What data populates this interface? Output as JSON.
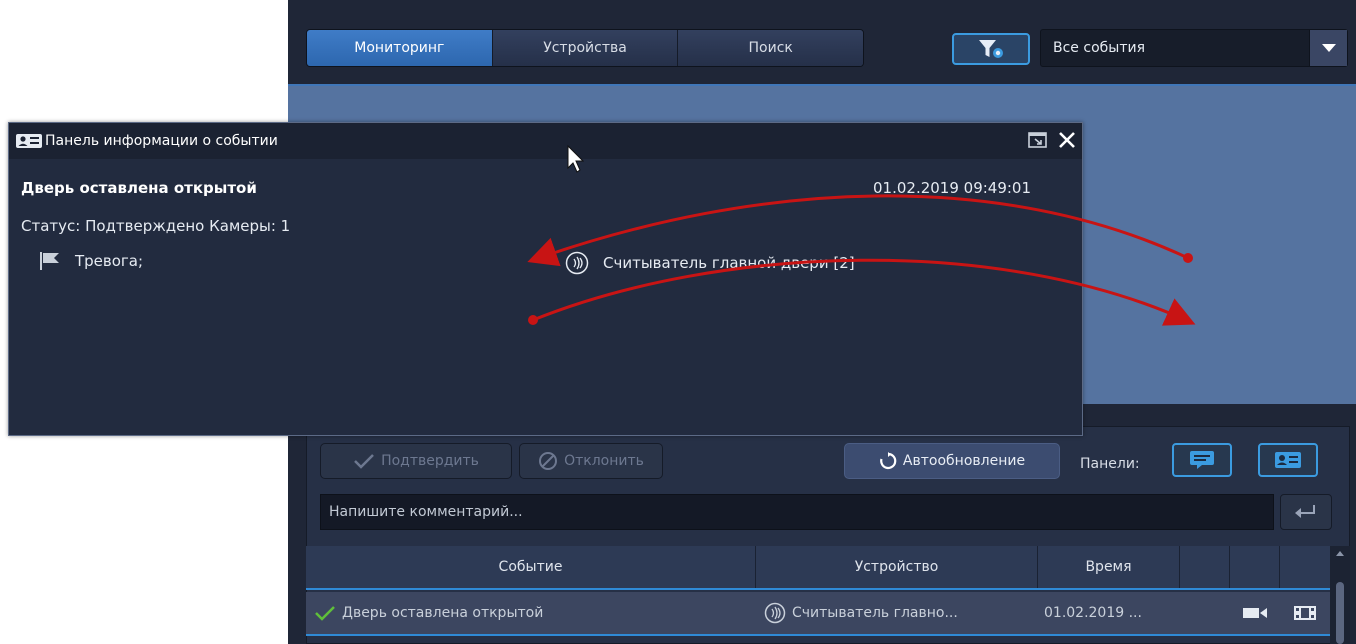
{
  "tabs": [
    {
      "label": "Мониторинг",
      "active": true
    },
    {
      "label": "Устройства",
      "active": false
    },
    {
      "label": "Поиск",
      "active": false
    }
  ],
  "event_filter": {
    "selected": "Все события"
  },
  "info_panel": {
    "title": "Панель информации о событии",
    "event_name": "Дверь оставлена открытой",
    "event_time": "01.02.2019 09:49:01",
    "status_line": "Статус: Подтверждено Камеры: 1",
    "flag_label": "Тревога;",
    "device_label": "Считыватель главной двери [2]"
  },
  "actions": {
    "confirm": "Подтвердить",
    "reject": "Отклонить",
    "autoupdate": "Автообновление",
    "panels_label": "Панели:"
  },
  "comment": {
    "placeholder": "Напишите комментарий..."
  },
  "table": {
    "headers": [
      "Событие",
      "Устройство",
      "Время",
      "",
      "",
      ""
    ],
    "rows": [
      {
        "event": "Дверь оставлена открытой",
        "device": "Считыватель главно...",
        "time": "01.02.2019 ..."
      }
    ]
  },
  "colors": {
    "accent": "#3b9be0",
    "active_tab": "#3f7cc7",
    "arrow": "#c81414",
    "confirm_check": "#5fbf3a"
  },
  "icons": [
    "filter-settings-icon",
    "dropdown-arrow-icon",
    "id-card-icon",
    "popout-icon",
    "close-icon",
    "flag-icon",
    "reader-icon",
    "check-icon",
    "reject-icon",
    "refresh-icon",
    "chat-icon",
    "enter-icon",
    "camera-icon",
    "film-icon",
    "cursor-icon"
  ]
}
